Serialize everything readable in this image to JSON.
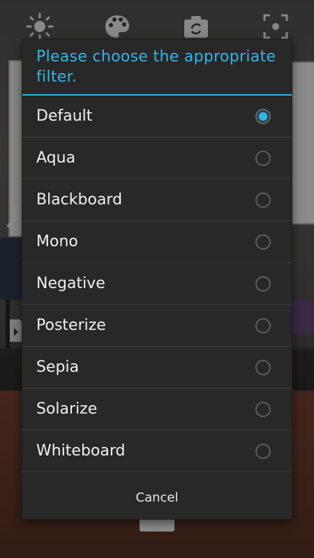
{
  "camera_toolbar": {
    "icons": [
      "brightness-icon",
      "palette-icon",
      "switch-camera-icon",
      "focus-icon"
    ]
  },
  "dialog": {
    "title": "Please choose the appropriate filter.",
    "accent_color": "#33b5e5",
    "options": [
      {
        "label": "Default",
        "selected": true
      },
      {
        "label": "Aqua",
        "selected": false
      },
      {
        "label": "Blackboard",
        "selected": false
      },
      {
        "label": "Mono",
        "selected": false
      },
      {
        "label": "Negative",
        "selected": false
      },
      {
        "label": "Posterize",
        "selected": false
      },
      {
        "label": "Sepia",
        "selected": false
      },
      {
        "label": "Solarize",
        "selected": false
      },
      {
        "label": "Whiteboard",
        "selected": false
      }
    ],
    "cancel_label": "Cancel"
  }
}
